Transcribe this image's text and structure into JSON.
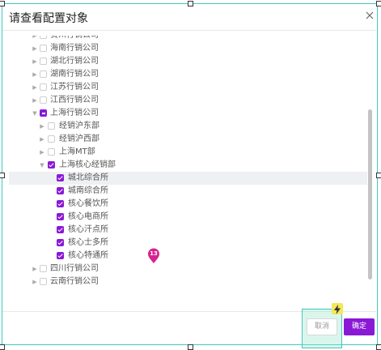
{
  "dialog": {
    "title": "请查看配置对象",
    "close_icon": "close-icon"
  },
  "tree": {
    "items": [
      {
        "label": "贵州行销公司",
        "level": 0,
        "expander": "collapsed",
        "check": "unchecked"
      },
      {
        "label": "海南行销公司",
        "level": 0,
        "expander": "collapsed",
        "check": "unchecked"
      },
      {
        "label": "湖北行销公司",
        "level": 0,
        "expander": "collapsed",
        "check": "unchecked"
      },
      {
        "label": "湖南行销公司",
        "level": 0,
        "expander": "collapsed",
        "check": "unchecked"
      },
      {
        "label": "江苏行销公司",
        "level": 0,
        "expander": "collapsed",
        "check": "unchecked"
      },
      {
        "label": "江西行销公司",
        "level": 0,
        "expander": "collapsed",
        "check": "unchecked"
      },
      {
        "label": "上海行销公司",
        "level": 0,
        "expander": "expanded",
        "check": "partial"
      },
      {
        "label": "经销沪东部",
        "level": 1,
        "expander": "collapsed",
        "check": "unchecked"
      },
      {
        "label": "经销沪西部",
        "level": 1,
        "expander": "collapsed",
        "check": "unchecked"
      },
      {
        "label": "上海MT部",
        "level": 1,
        "expander": "collapsed",
        "check": "unchecked"
      },
      {
        "label": "上海核心经销部",
        "level": 1,
        "expander": "expanded",
        "check": "checked"
      },
      {
        "label": "城北综合所",
        "level": 2,
        "expander": "none",
        "check": "checked",
        "highlight": true
      },
      {
        "label": "城南综合所",
        "level": 2,
        "expander": "none",
        "check": "checked"
      },
      {
        "label": "核心餐饮所",
        "level": 2,
        "expander": "none",
        "check": "checked"
      },
      {
        "label": "核心电商所",
        "level": 2,
        "expander": "none",
        "check": "checked"
      },
      {
        "label": "核心汗点所",
        "level": 2,
        "expander": "none",
        "check": "checked"
      },
      {
        "label": "核心士多所",
        "level": 2,
        "expander": "none",
        "check": "checked"
      },
      {
        "label": "核心特通所",
        "level": 2,
        "expander": "none",
        "check": "checked"
      },
      {
        "label": "四川行销公司",
        "level": 0,
        "expander": "collapsed",
        "check": "unchecked"
      },
      {
        "label": "云南行销公司",
        "level": 0,
        "expander": "collapsed",
        "check": "unchecked"
      }
    ]
  },
  "footer": {
    "cancel_label": "取消",
    "ok_label": "确定"
  },
  "overlay": {
    "step_number": "13",
    "flash_icon": "lightning-icon"
  },
  "colors": {
    "accent": "#8a19d6",
    "marker": "#d6238f",
    "selection_frame": "#40c9c0",
    "flash_badge": "#f4e95a"
  }
}
